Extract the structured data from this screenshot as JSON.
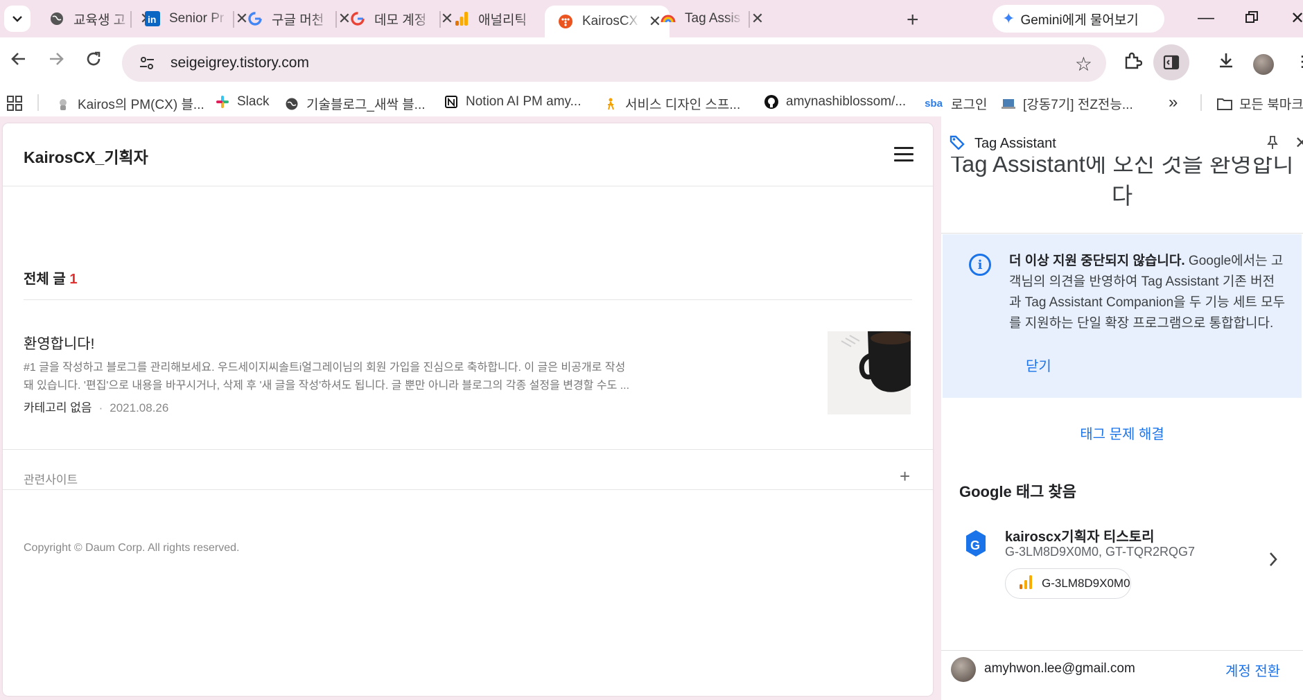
{
  "tabs": [
    {
      "title": "교육생 고",
      "icon": "globe-icon"
    },
    {
      "title": "Senior Pr",
      "icon": "linkedin-icon"
    },
    {
      "title": "구글 머천",
      "icon": "google-icon"
    },
    {
      "title": "데모 계정",
      "icon": "google-icon"
    },
    {
      "title": "애널리틱",
      "icon": "analytics-icon"
    },
    {
      "title": "KairosCX",
      "icon": "tistory-icon",
      "active": true
    },
    {
      "title": "Tag Assis",
      "icon": "tag-assistant-icon"
    }
  ],
  "gemini_button": "Gemini에게 물어보기",
  "address_bar": {
    "url": "seigeigrey.tistory.com"
  },
  "bookmarks": [
    {
      "label": "Kairos의 PM(CX) 블...",
      "icon": "kairos-icon"
    },
    {
      "label": "Slack",
      "icon": "slack-icon"
    },
    {
      "label": "기술블로그_새싹 블...",
      "icon": "globe-icon"
    },
    {
      "label": "Notion AI PM amy...",
      "icon": "notion-icon"
    },
    {
      "label": "서비스 디자인 스프...",
      "icon": "service-design-icon"
    },
    {
      "label": "amynashiblossom/...",
      "icon": "github-icon"
    },
    {
      "label": "로그인",
      "icon": "sba-icon",
      "icon_text": "sba"
    },
    {
      "label": "[강동7기] 전Z전능...",
      "icon": "laptop-icon"
    }
  ],
  "all_bookmarks": "모든 북마크",
  "blog": {
    "title": "KairosCX_기획자",
    "section_label": "전체 글",
    "section_count": "1",
    "post": {
      "title": "환영합니다!",
      "excerpt_line1": "#1 글을 작성하고 블로그를 관리해보세요. 우드세이지씨솔트i얼그레이님의 회원 가입을 진심으로 축하합니다. 이 글은 비공개로 작성",
      "excerpt_line2": "돼 있습니다. '편집'으로 내용을 바꾸시거나, 삭제 후 '새 글을 작성'하셔도 됩니다. 글 뿐만 아니라 블로그의 각종 설정을 변경할 수도 ...",
      "category": "카테고리 없음",
      "date": "2021.08.26"
    },
    "related_sites": "관련사이트",
    "copyright": "Copyright © Daum Corp. All rights reserved."
  },
  "tag_assistant": {
    "panel_title": "Tag Assistant",
    "welcome": "Tag Assistant에 오신 것을 환영합니다",
    "notice_bold": "더 이상 지원 중단되지 않습니다.",
    "notice_body": " Google에서는 고객님의 의견을 반영하여 Tag Assistant 기존 버전과 Tag Assistant Companion을 두 기능 세트 모두를 지원하는 단일 확장 프로그램으로 통합합니다.",
    "notice_close": "닫기",
    "troubleshoot": "태그 문제 해결",
    "found_heading": "Google 태그 찾음",
    "tag": {
      "name": "kairoscx기획자 티스토리",
      "ids": "G-3LM8D9X0M0, GT-TQR2RQG7",
      "chip": "G-3LM8D9X0M0"
    },
    "account_email": "amyhwon.lee@gmail.com",
    "switch_account": "계정 전환"
  },
  "colors": {
    "accent_blue": "#1a73e8",
    "count_red": "#e03131",
    "notice_bg": "#e8f0fd"
  }
}
